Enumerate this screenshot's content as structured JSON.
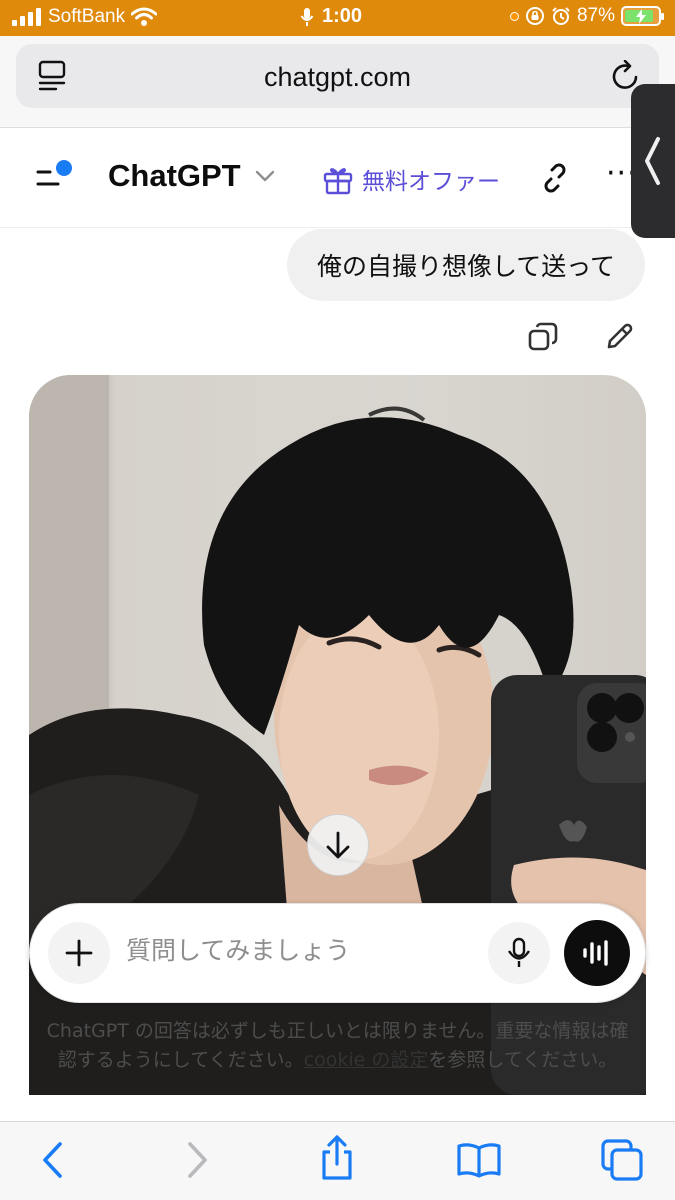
{
  "status_bar": {
    "carrier": "SoftBank",
    "time": "1:00",
    "battery_percent": "87%",
    "battery_level": 0.87,
    "icons": [
      "signal-icon",
      "wifi-icon",
      "mic-icon",
      "orange-dot-indicator",
      "orientation-lock-icon",
      "alarm-icon",
      "battery-charging-icon"
    ]
  },
  "browser": {
    "url": "chatgpt.com",
    "icons": [
      "reader-icon",
      "reload-icon"
    ]
  },
  "app_header": {
    "title": "ChatGPT",
    "offer_label": "無料オファー",
    "more_label": "···",
    "icons": [
      "sidebar-menu-icon",
      "chevron-down-icon",
      "gift-icon",
      "share-link-icon"
    ]
  },
  "conversation": {
    "user_message": "俺の自撮り想像して送って",
    "message_action_icons": [
      "copy-icon",
      "edit-icon"
    ],
    "image_alt": "自撮り"
  },
  "composer": {
    "placeholder": "質問してみましょう",
    "value": "",
    "icons": [
      "plus-icon",
      "mic-icon",
      "voice-mode-icon"
    ]
  },
  "disclaimer": {
    "text_before": "ChatGPT の回答は必ずしも正しいとは限りません。重要な情報は確認するようにしてください。",
    "link_text": "cookie の設定",
    "text_after": "を参照してください。"
  },
  "toolbar": {
    "icons": [
      "back-icon",
      "forward-icon",
      "share-icon",
      "bookmarks-icon",
      "tabs-icon"
    ]
  },
  "colors": {
    "status_bar": "#e08a0c",
    "accent_purple": "#5b4fd8",
    "toolbar_blue": "#1a7cf5",
    "notification_dot": "#1a7cf5"
  }
}
